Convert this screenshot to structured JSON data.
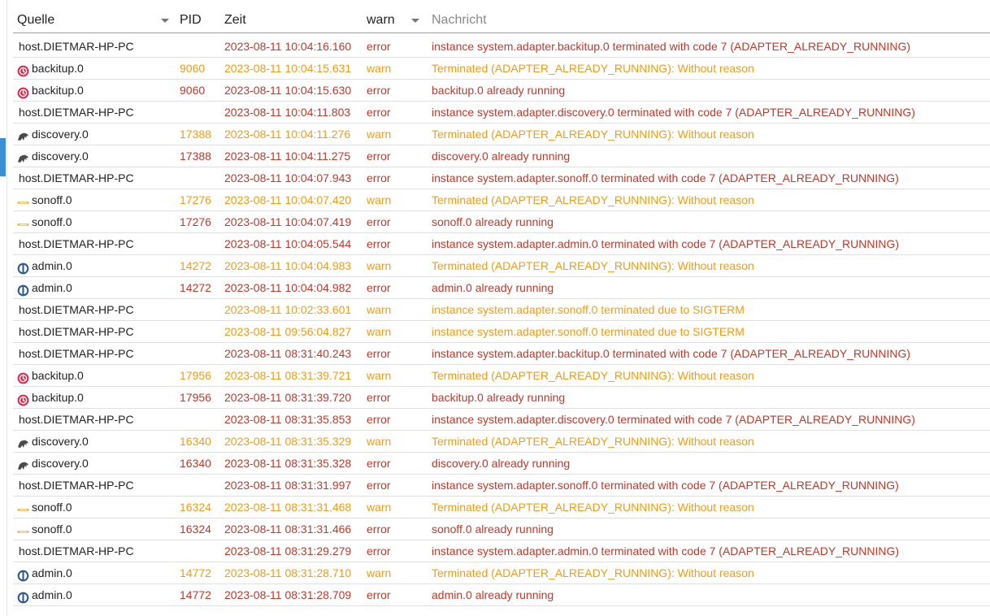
{
  "header": {
    "source_label": "Quelle",
    "pid_label": "PID",
    "time_label": "Zeit",
    "severity_filter": "warn",
    "message_placeholder": "Nachricht"
  },
  "colors": {
    "error": "#c0392b",
    "warn": "#f39c12",
    "accent": "#3a8fd6"
  },
  "rows": [
    {
      "source": "host.DIETMAR-HP-PC",
      "icon": "",
      "pid": "",
      "time": "2023-08-11 10:04:16.160",
      "severity": "error",
      "message": "instance system.adapter.backitup.0 terminated with code 7 (ADAPTER_ALREADY_RUNNING)"
    },
    {
      "source": "backitup.0",
      "icon": "backitup-icon",
      "pid": "9060",
      "time": "2023-08-11 10:04:15.631",
      "severity": "warn",
      "message": "Terminated (ADAPTER_ALREADY_RUNNING): Without reason"
    },
    {
      "source": "backitup.0",
      "icon": "backitup-icon",
      "pid": "9060",
      "time": "2023-08-11 10:04:15.630",
      "severity": "error",
      "message": "backitup.0 already running"
    },
    {
      "source": "host.DIETMAR-HP-PC",
      "icon": "",
      "pid": "",
      "time": "2023-08-11 10:04:11.803",
      "severity": "error",
      "message": "instance system.adapter.discovery.0 terminated with code 7 (ADAPTER_ALREADY_RUNNING)"
    },
    {
      "source": "discovery.0",
      "icon": "discovery-icon",
      "pid": "17388",
      "time": "2023-08-11 10:04:11.276",
      "severity": "warn",
      "message": "Terminated (ADAPTER_ALREADY_RUNNING): Without reason"
    },
    {
      "source": "discovery.0",
      "icon": "discovery-icon",
      "pid": "17388",
      "time": "2023-08-11 10:04:11.275",
      "severity": "error",
      "message": "discovery.0 already running"
    },
    {
      "source": "host.DIETMAR-HP-PC",
      "icon": "",
      "pid": "",
      "time": "2023-08-11 10:04:07.943",
      "severity": "error",
      "message": "instance system.adapter.sonoff.0 terminated with code 7 (ADAPTER_ALREADY_RUNNING)"
    },
    {
      "source": "sonoff.0",
      "icon": "sonoff-icon",
      "pid": "17276",
      "time": "2023-08-11 10:04:07.420",
      "severity": "warn",
      "message": "Terminated (ADAPTER_ALREADY_RUNNING): Without reason"
    },
    {
      "source": "sonoff.0",
      "icon": "sonoff-icon",
      "pid": "17276",
      "time": "2023-08-11 10:04:07.419",
      "severity": "error",
      "message": "sonoff.0 already running"
    },
    {
      "source": "host.DIETMAR-HP-PC",
      "icon": "",
      "pid": "",
      "time": "2023-08-11 10:04:05.544",
      "severity": "error",
      "message": "instance system.adapter.admin.0 terminated with code 7 (ADAPTER_ALREADY_RUNNING)"
    },
    {
      "source": "admin.0",
      "icon": "admin-icon",
      "pid": "14272",
      "time": "2023-08-11 10:04:04.983",
      "severity": "warn",
      "message": "Terminated (ADAPTER_ALREADY_RUNNING): Without reason"
    },
    {
      "source": "admin.0",
      "icon": "admin-icon",
      "pid": "14272",
      "time": "2023-08-11 10:04:04.982",
      "severity": "error",
      "message": "admin.0 already running"
    },
    {
      "source": "host.DIETMAR-HP-PC",
      "icon": "",
      "pid": "",
      "time": "2023-08-11 10:02:33.601",
      "severity": "warn",
      "message": "instance system.adapter.sonoff.0 terminated due to SIGTERM"
    },
    {
      "source": "host.DIETMAR-HP-PC",
      "icon": "",
      "pid": "",
      "time": "2023-08-11 09:56:04.827",
      "severity": "warn",
      "message": "instance system.adapter.sonoff.0 terminated due to SIGTERM"
    },
    {
      "source": "host.DIETMAR-HP-PC",
      "icon": "",
      "pid": "",
      "time": "2023-08-11 08:31:40.243",
      "severity": "error",
      "message": "instance system.adapter.backitup.0 terminated with code 7 (ADAPTER_ALREADY_RUNNING)"
    },
    {
      "source": "backitup.0",
      "icon": "backitup-icon",
      "pid": "17956",
      "time": "2023-08-11 08:31:39.721",
      "severity": "warn",
      "message": "Terminated (ADAPTER_ALREADY_RUNNING): Without reason"
    },
    {
      "source": "backitup.0",
      "icon": "backitup-icon",
      "pid": "17956",
      "time": "2023-08-11 08:31:39.720",
      "severity": "error",
      "message": "backitup.0 already running"
    },
    {
      "source": "host.DIETMAR-HP-PC",
      "icon": "",
      "pid": "",
      "time": "2023-08-11 08:31:35.853",
      "severity": "error",
      "message": "instance system.adapter.discovery.0 terminated with code 7 (ADAPTER_ALREADY_RUNNING)"
    },
    {
      "source": "discovery.0",
      "icon": "discovery-icon",
      "pid": "16340",
      "time": "2023-08-11 08:31:35.329",
      "severity": "warn",
      "message": "Terminated (ADAPTER_ALREADY_RUNNING): Without reason"
    },
    {
      "source": "discovery.0",
      "icon": "discovery-icon",
      "pid": "16340",
      "time": "2023-08-11 08:31:35.328",
      "severity": "error",
      "message": "discovery.0 already running"
    },
    {
      "source": "host.DIETMAR-HP-PC",
      "icon": "",
      "pid": "",
      "time": "2023-08-11 08:31:31.997",
      "severity": "error",
      "message": "instance system.adapter.sonoff.0 terminated with code 7 (ADAPTER_ALREADY_RUNNING)"
    },
    {
      "source": "sonoff.0",
      "icon": "sonoff-icon",
      "pid": "16324",
      "time": "2023-08-11 08:31:31.468",
      "severity": "warn",
      "message": "Terminated (ADAPTER_ALREADY_RUNNING): Without reason"
    },
    {
      "source": "sonoff.0",
      "icon": "sonoff-icon",
      "pid": "16324",
      "time": "2023-08-11 08:31:31.466",
      "severity": "error",
      "message": "sonoff.0 already running"
    },
    {
      "source": "host.DIETMAR-HP-PC",
      "icon": "",
      "pid": "",
      "time": "2023-08-11 08:31:29.279",
      "severity": "error",
      "message": "instance system.adapter.admin.0 terminated with code 7 (ADAPTER_ALREADY_RUNNING)"
    },
    {
      "source": "admin.0",
      "icon": "admin-icon",
      "pid": "14772",
      "time": "2023-08-11 08:31:28.710",
      "severity": "warn",
      "message": "Terminated (ADAPTER_ALREADY_RUNNING): Without reason"
    },
    {
      "source": "admin.0",
      "icon": "admin-icon",
      "pid": "14772",
      "time": "2023-08-11 08:31:28.709",
      "severity": "error",
      "message": "admin.0 already running"
    }
  ]
}
